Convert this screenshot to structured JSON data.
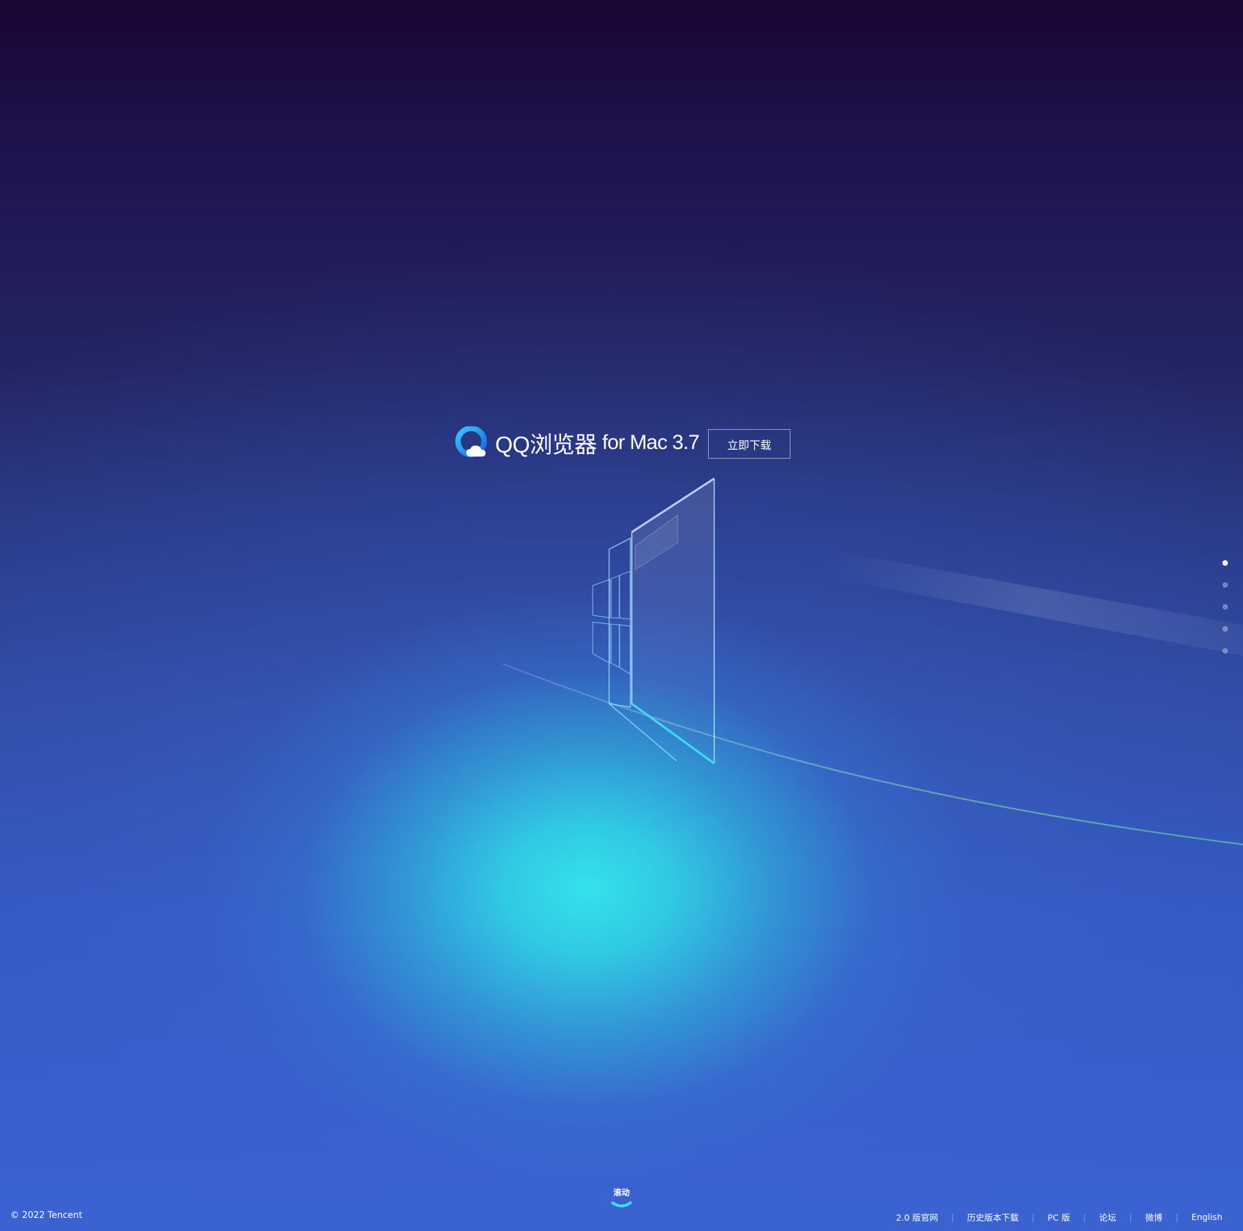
{
  "hero": {
    "brand_name": "QQ浏览器",
    "brand_sub": "for Mac 3.7",
    "download_label": "立即下载",
    "logo_icon": "qq-browser-logo-icon"
  },
  "pager": {
    "total": 5,
    "active_index": 0
  },
  "scroll_hint": {
    "label": "滚动",
    "icon": "chevron-down-icon"
  },
  "footer": {
    "copyright": "© 2022 Tencent",
    "links": [
      "2.0 版官网",
      "历史版本下载",
      "PC 版",
      "论坛",
      "微博",
      "English"
    ]
  },
  "colors": {
    "bg_top": "#1a0634",
    "bg_bottom": "#3a62d2",
    "glow": "#34e4ec",
    "logo_blue": "#1e90ff"
  }
}
